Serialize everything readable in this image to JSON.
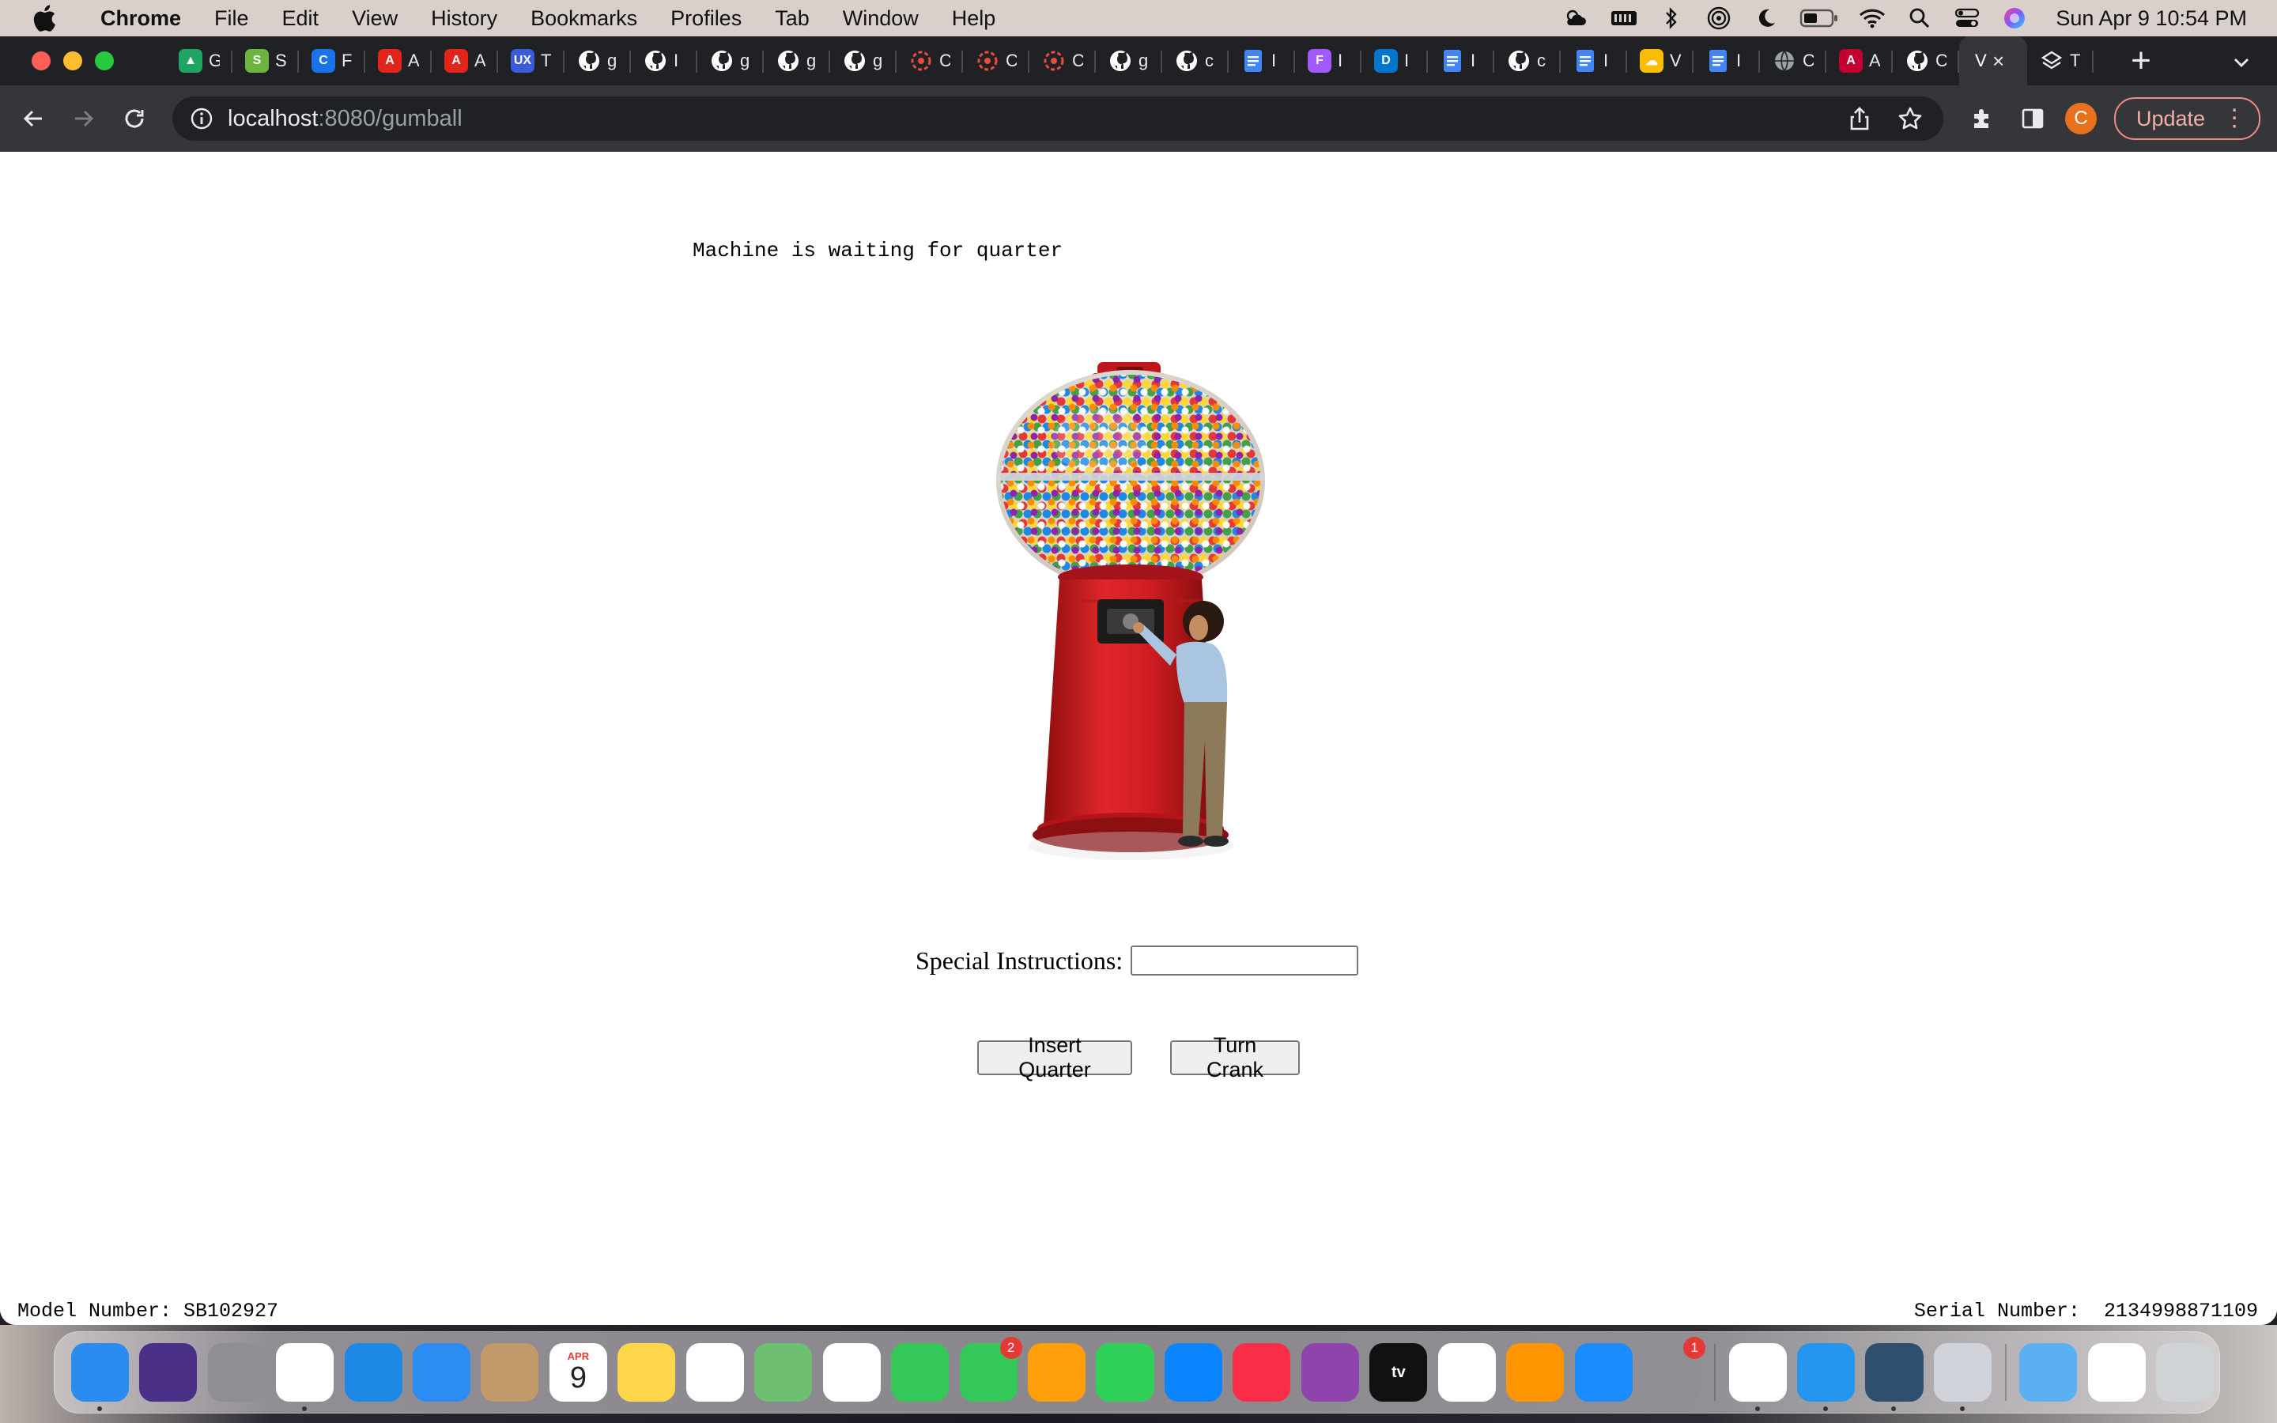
{
  "menubar": {
    "app_name": "Chrome",
    "items": [
      "File",
      "Edit",
      "View",
      "History",
      "Bookmarks",
      "Profiles",
      "Tab",
      "Window",
      "Help"
    ],
    "clock": "Sun Apr 9  10:54 PM"
  },
  "browser": {
    "tabs": [
      {
        "icon": "google-drive-icon",
        "title": "G",
        "color": "#1fa463"
      },
      {
        "icon": "spring-icon",
        "title": "S",
        "color": "#6db33f"
      },
      {
        "icon": "c-icon",
        "title": "F",
        "color": "#1a73e8"
      },
      {
        "icon": "adobe-icon",
        "title": "A",
        "color": "#e1251b"
      },
      {
        "icon": "adobe-icon",
        "title": "A",
        "color": "#e1251b"
      },
      {
        "icon": "ux-icon",
        "title": "T",
        "color": "#3b5bdb"
      },
      {
        "icon": "github-icon",
        "title": "g",
        "color": "#ffffff"
      },
      {
        "icon": "github-icon",
        "title": "I",
        "color": "#ffffff"
      },
      {
        "icon": "github-icon",
        "title": "g",
        "color": "#ffffff"
      },
      {
        "icon": "github-icon",
        "title": "g",
        "color": "#ffffff"
      },
      {
        "icon": "github-icon",
        "title": "g",
        "color": "#ffffff"
      },
      {
        "icon": "openai-icon",
        "title": "C",
        "color": "#e74c3c"
      },
      {
        "icon": "openai-icon",
        "title": "C",
        "color": "#e74c3c"
      },
      {
        "icon": "openai-icon",
        "title": "C",
        "color": "#e74c3c"
      },
      {
        "icon": "github-icon",
        "title": "g",
        "color": "#ffffff"
      },
      {
        "icon": "github-icon",
        "title": "c",
        "color": "#ffffff"
      },
      {
        "icon": "google-docs-icon",
        "title": "I",
        "color": "#4285f4"
      },
      {
        "icon": "figma-icon",
        "title": "I",
        "color": "#a259ff"
      },
      {
        "icon": "dell-icon",
        "title": "I",
        "color": "#0076ce"
      },
      {
        "icon": "google-docs-icon",
        "title": "I",
        "color": "#4285f4"
      },
      {
        "icon": "github-icon",
        "title": "c",
        "color": "#ffffff"
      },
      {
        "icon": "google-docs-icon",
        "title": "I",
        "color": "#4285f4"
      },
      {
        "icon": "google-cloud-icon",
        "title": "V",
        "color": "#fbbc04"
      },
      {
        "icon": "google-docs-icon",
        "title": "I",
        "color": "#4285f4"
      },
      {
        "icon": "globe-icon",
        "title": "C",
        "color": "#9aa0a6"
      },
      {
        "icon": "angular-icon",
        "title": "A",
        "color": "#c3002f"
      },
      {
        "icon": "github-icon",
        "title": "C",
        "color": "#ffffff"
      }
    ],
    "active_tab": {
      "title": "V",
      "close": "×"
    },
    "extra_tab": {
      "icon": "layers-icon",
      "title": "T"
    },
    "new_tab": "+",
    "url_host": "localhost",
    "url_path": ":8080/gumball",
    "profile_initial": "C",
    "update_label": "Update"
  },
  "page": {
    "status_message": "Machine is waiting for quarter",
    "special_instructions_label": "Special Instructions:",
    "special_instructions_value": "",
    "insert_quarter_label": "Insert Quarter",
    "turn_crank_label": "Turn Crank",
    "model_number": "Model Number: SB102927",
    "serial_number": "Serial Number:  2134998871109"
  },
  "dock": {
    "apps": [
      {
        "name": "finder",
        "color": "#2a8cf0",
        "label": "",
        "running": true
      },
      {
        "name": "siri",
        "color": "#4a2f86",
        "label": "",
        "running": false
      },
      {
        "name": "launchpad",
        "color": "#8e8e93",
        "label": "",
        "running": false
      },
      {
        "name": "chrome",
        "color": "#ffffff",
        "label": "",
        "running": true
      },
      {
        "name": "safari",
        "color": "#1e88e5",
        "label": "",
        "running": false
      },
      {
        "name": "mail",
        "color": "#2b8cf2",
        "label": "",
        "running": false
      },
      {
        "name": "contacts",
        "color": "#c09a6b",
        "label": "",
        "running": false
      },
      {
        "name": "calendar",
        "color": "#ffffff",
        "label": "9",
        "month": "APR",
        "running": false
      },
      {
        "name": "notes",
        "color": "#ffd54a",
        "label": "",
        "running": false
      },
      {
        "name": "reminders",
        "color": "#ffffff",
        "label": "",
        "running": false
      },
      {
        "name": "maps",
        "color": "#6fbf73",
        "label": "",
        "running": false
      },
      {
        "name": "photos",
        "color": "#ffffff",
        "label": "",
        "running": false
      },
      {
        "name": "messages",
        "color": "#34c759",
        "label": "",
        "running": false
      },
      {
        "name": "facetime",
        "color": "#34c759",
        "label": "",
        "badge": "2",
        "running": false
      },
      {
        "name": "pages",
        "color": "#ff9f0a",
        "label": "",
        "running": false
      },
      {
        "name": "numbers",
        "color": "#30d158",
        "label": "",
        "running": false
      },
      {
        "name": "keynote",
        "color": "#0a84ff",
        "label": "",
        "running": false
      },
      {
        "name": "music",
        "color": "#fa2d48",
        "label": "",
        "running": false
      },
      {
        "name": "podcasts",
        "color": "#8e44ad",
        "label": "",
        "running": false
      },
      {
        "name": "apple-tv",
        "color": "#111111",
        "label": "tv",
        "running": false
      },
      {
        "name": "news",
        "color": "#ffffff",
        "label": "",
        "running": false
      },
      {
        "name": "books",
        "color": "#ff9500",
        "label": "",
        "running": false
      },
      {
        "name": "app-store",
        "color": "#1a8cff",
        "label": "",
        "running": false
      },
      {
        "name": "system-settings",
        "color": "#8e8e93",
        "label": "",
        "badge": "1",
        "running": false
      },
      {
        "name": "vscode",
        "color": "#ffffff",
        "label": "",
        "running": true
      },
      {
        "name": "docker",
        "color": "#2496ed",
        "label": "",
        "running": true
      },
      {
        "name": "mysql-workbench",
        "color": "#2f4f6f",
        "label": "",
        "running": true
      },
      {
        "name": "preview",
        "color": "#d0d4da",
        "label": "",
        "running": true
      }
    ],
    "stacks": [
      {
        "name": "downloads-folder",
        "color": "#5ab0f0"
      },
      {
        "name": "recent-window",
        "color": "#ffffff"
      },
      {
        "name": "trash",
        "color": "#cfd3d6"
      }
    ]
  }
}
